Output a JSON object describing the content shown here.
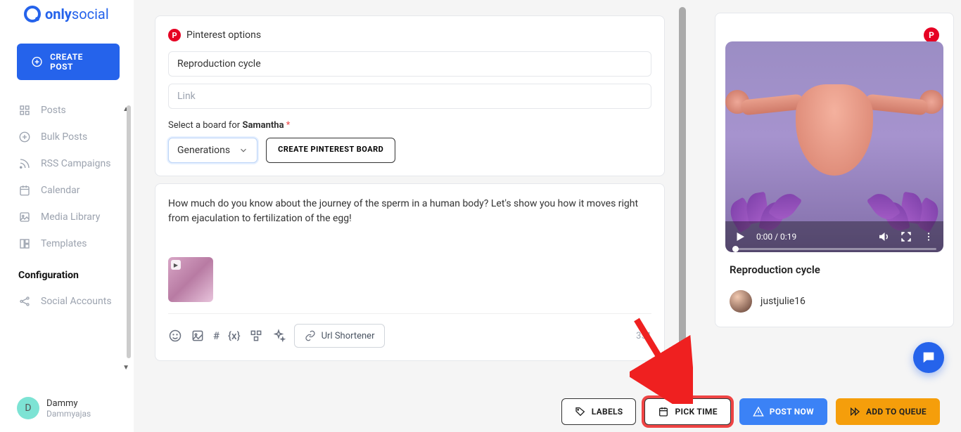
{
  "brand": {
    "name_bold": "only",
    "name_light": "social"
  },
  "sidebar": {
    "create_label": "CREATE POST",
    "items": [
      {
        "label": "Posts"
      },
      {
        "label": "Bulk Posts"
      },
      {
        "label": "RSS Campaigns"
      },
      {
        "label": "Calendar"
      },
      {
        "label": "Media Library"
      },
      {
        "label": "Templates"
      }
    ],
    "config_label": "Configuration",
    "config_items": [
      {
        "label": "Social Accounts"
      }
    ],
    "user": {
      "name": "Dammy",
      "sub": "Dammyajas",
      "initial": "D"
    }
  },
  "pinterest": {
    "header": "Pinterest options",
    "title_value": "Reproduction cycle",
    "link_placeholder": "Link",
    "select_label_pre": "Select a board for ",
    "select_label_name": "Samantha",
    "select_required": "*",
    "select_value": "Generations",
    "create_board_label": "CREATE PINTEREST BOARD"
  },
  "editor": {
    "text": "How much do you know about the journey of the sperm in a human body? Let's show you how it moves right from ejaculation to fertilization of the egg!",
    "url_shortener_label": "Url Shortener",
    "char_count": "351",
    "hash": "#",
    "var": "{x}"
  },
  "actions": {
    "labels": "LABELS",
    "pick_time": "PICK TIME",
    "post_now": "POST NOW",
    "add_queue": "ADD TO QUEUE"
  },
  "preview": {
    "title": "Reproduction cycle",
    "username": "justjulie16",
    "video_time": "0:00 / 0:19"
  }
}
